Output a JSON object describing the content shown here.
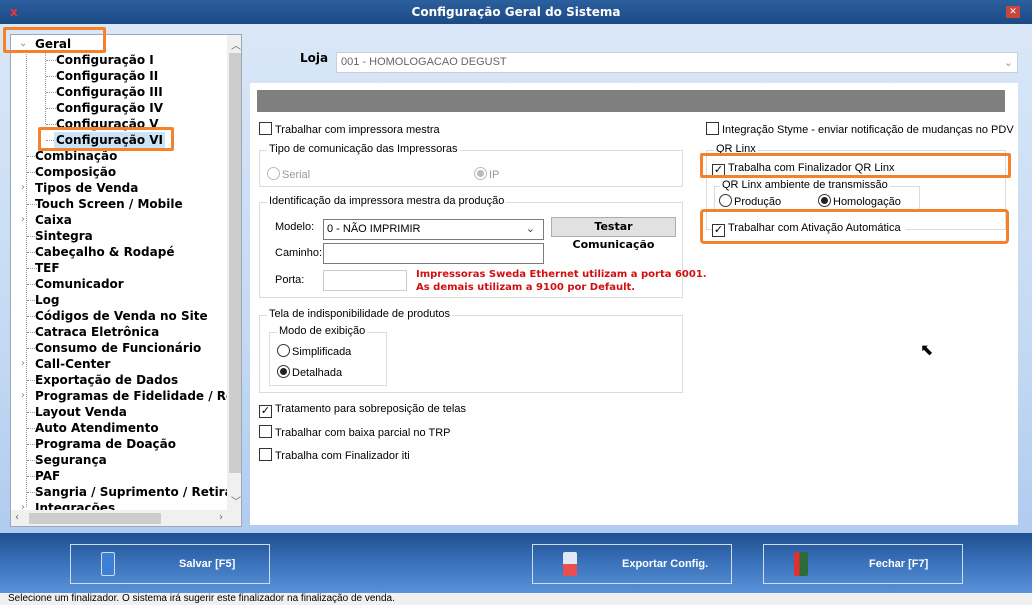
{
  "window": {
    "title": "Configuração Geral do Sistema",
    "app_icon": "x-logo-icon",
    "close": "x"
  },
  "tree": {
    "root": "Geral",
    "children": [
      "Configuração I",
      "Configuração II",
      "Configuração III",
      "Configuração IV",
      "Configuração V",
      "Configuração VI"
    ],
    "selected": "Configuração VI",
    "items": [
      {
        "label": "Combinação",
        "expandable": false
      },
      {
        "label": "Composição",
        "expandable": false
      },
      {
        "label": "Tipos de Venda",
        "expandable": true
      },
      {
        "label": "Touch Screen / Mobile",
        "expandable": false
      },
      {
        "label": "Caixa",
        "expandable": true
      },
      {
        "label": "Sintegra",
        "expandable": false
      },
      {
        "label": "Cabeçalho & Rodapé",
        "expandable": false
      },
      {
        "label": "TEF",
        "expandable": false
      },
      {
        "label": "Comunicador",
        "expandable": false
      },
      {
        "label": "Log",
        "expandable": false
      },
      {
        "label": "Códigos de Venda no Site",
        "expandable": false
      },
      {
        "label": "Catraca Eletrônica",
        "expandable": false
      },
      {
        "label": "Consumo de Funcionário",
        "expandable": false
      },
      {
        "label": "Call-Center",
        "expandable": true
      },
      {
        "label": "Exportação de Dados",
        "expandable": false
      },
      {
        "label": "Programas de Fidelidade / Rela",
        "expandable": true
      },
      {
        "label": "Layout Venda",
        "expandable": false
      },
      {
        "label": "Auto Atendimento",
        "expandable": false
      },
      {
        "label": "Programa de Doação",
        "expandable": false
      },
      {
        "label": "Segurança",
        "expandable": false
      },
      {
        "label": "PAF",
        "expandable": false
      },
      {
        "label": "Sangria / Suprimento / Retirac",
        "expandable": false
      },
      {
        "label": "Integrações",
        "expandable": true
      }
    ]
  },
  "loja": {
    "label": "Loja",
    "value": "001 - HOMOLOGACAO DEGUST"
  },
  "left": {
    "impressora_mestra": {
      "label": "Trabalhar com impressora mestra",
      "checked": false
    },
    "tipo_comunicacao": {
      "title": "Tipo de comunicação das Impressoras",
      "serial": "Serial",
      "ip": "IP",
      "selected": "IP",
      "disabled": true
    },
    "identificacao": {
      "title": "Identificação da impressora mestra da produção",
      "modelo_label": "Modelo:",
      "modelo_value": "0 - NÃO IMPRIMIR",
      "caminho_label": "Caminho:",
      "caminho_value": "",
      "porta_label": "Porta:",
      "porta_value": "",
      "testar": "Testar Comunicação",
      "warn1": "Impressoras Sweda Ethernet utilizam a porta 6001.",
      "warn2": "As demais utilizam a 9100 por Default."
    },
    "indisponibilidade": {
      "title": "Tela de indisponibilidade de produtos",
      "modo_title": "Modo de exibição",
      "simplificada": "Simplificada",
      "detalhada": "Detalhada",
      "selected": "Detalhada"
    },
    "sobreposicao": {
      "label": "Tratamento para sobreposição de telas",
      "checked": true
    },
    "baixa_parcial": {
      "label": "Trabalhar com baixa parcial no TRP",
      "checked": false
    },
    "iti": {
      "label": "Trabalha com Finalizador iti",
      "checked": false
    }
  },
  "right": {
    "styme": {
      "label": "Integração Styme - enviar notificação de mudanças no PDV",
      "checked": false
    },
    "qr_title": "QR Linx",
    "qr_finalizador": {
      "label": "Trabalha com Finalizador QR Linx",
      "checked": true
    },
    "ambiente": {
      "title": "QR Linx ambiente de transmissão",
      "producao": "Produção",
      "homologacao": "Homologação",
      "selected": "Homologação"
    },
    "ativacao": {
      "label": "Trabalhar com Ativação Automática",
      "checked": true
    }
  },
  "buttons": {
    "salvar": "Salvar [F5]",
    "exportar": "Exportar Config.",
    "fechar": "Fechar [F7]"
  },
  "status": "Selecione um finalizador. O sistema irá sugerir este finalizador na finalização de venda.",
  "colors": {
    "highlight": "#f5822a",
    "warning": "#d01010",
    "titlebar": "#1b4a85"
  }
}
